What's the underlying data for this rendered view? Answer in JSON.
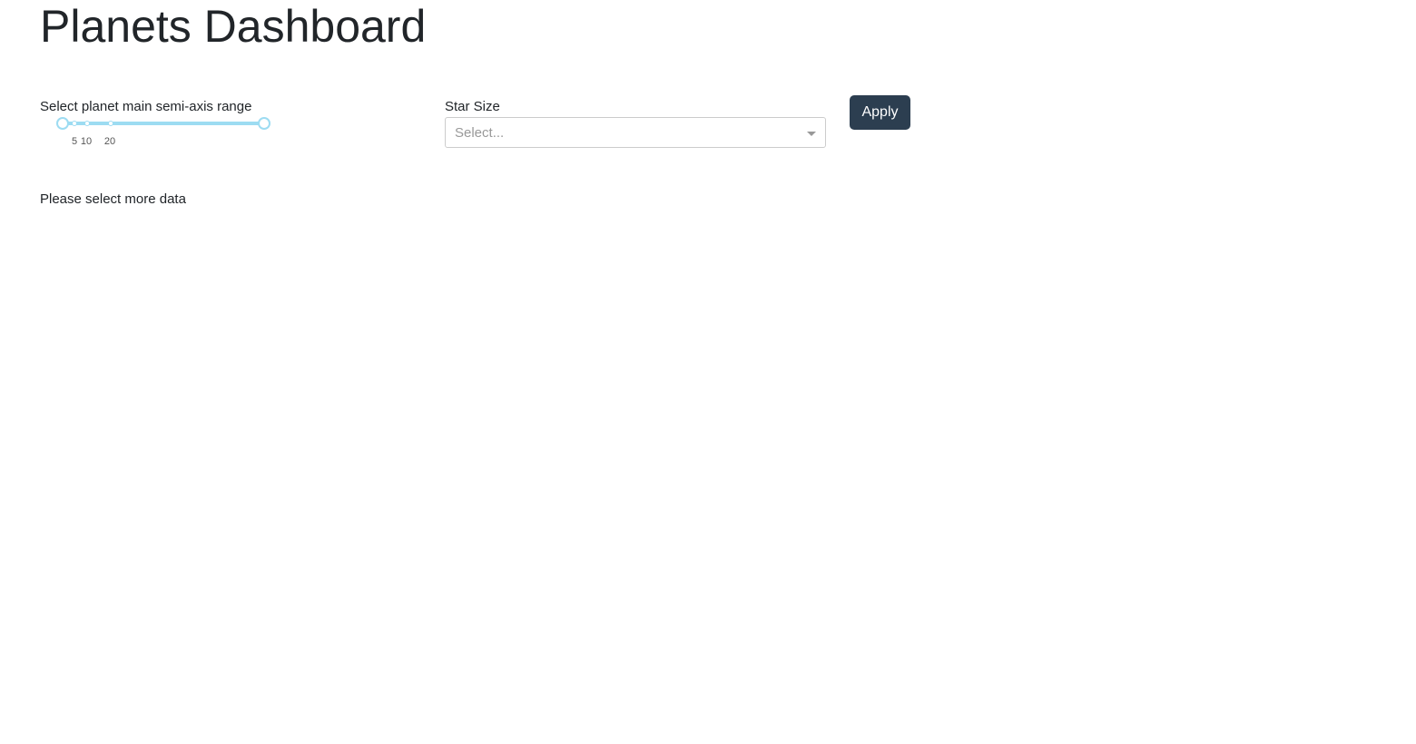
{
  "header": {
    "title": "Planets Dashboard"
  },
  "controls": {
    "semi_axis_slider": {
      "label": "Select planet main semi-axis range",
      "marks": [
        "5",
        "10",
        "20"
      ]
    },
    "star_size": {
      "label": "Star Size",
      "placeholder": "Select..."
    },
    "apply_label": "Apply"
  },
  "output": {
    "message": "Please select more data"
  },
  "colors": {
    "slider_accent": "#9ddcf2",
    "button_bg": "#2c3e50",
    "button_text": "#ffffff"
  },
  "icons": {
    "select_arrow": "caret-down-icon"
  }
}
